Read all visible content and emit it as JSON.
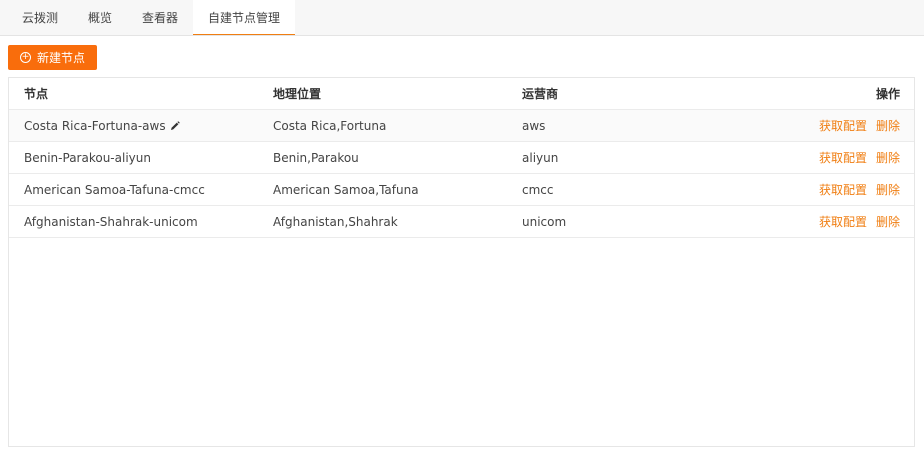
{
  "tabs": [
    {
      "label": "云拨测"
    },
    {
      "label": "概览"
    },
    {
      "label": "查看器"
    },
    {
      "label": "自建节点管理"
    }
  ],
  "new_button": {
    "label": "新建节点"
  },
  "table": {
    "headers": {
      "node": "节点",
      "geo": "地理位置",
      "isp": "运营商",
      "ops": "操作"
    },
    "rows": [
      {
        "node": "Costa Rica-Fortuna-aws",
        "geo": "Costa Rica,Fortuna",
        "isp": "aws",
        "get_config": "获取配置",
        "delete": "删除"
      },
      {
        "node": "Benin-Parakou-aliyun",
        "geo": "Benin,Parakou",
        "isp": "aliyun",
        "get_config": "获取配置",
        "delete": "删除"
      },
      {
        "node": "American Samoa-Tafuna-cmcc",
        "geo": "American Samoa,Tafuna",
        "isp": "cmcc",
        "get_config": "获取配置",
        "delete": "删除"
      },
      {
        "node": "Afghanistan-Shahrak-unicom",
        "geo": "Afghanistan,Shahrak",
        "isp": "unicom",
        "get_config": "获取配置",
        "delete": "删除"
      }
    ]
  },
  "colors": {
    "accent": "#f96d0c",
    "link": "#f07e12"
  },
  "icons": {
    "edit": "pencil-icon",
    "add": "plus-circle-icon"
  }
}
